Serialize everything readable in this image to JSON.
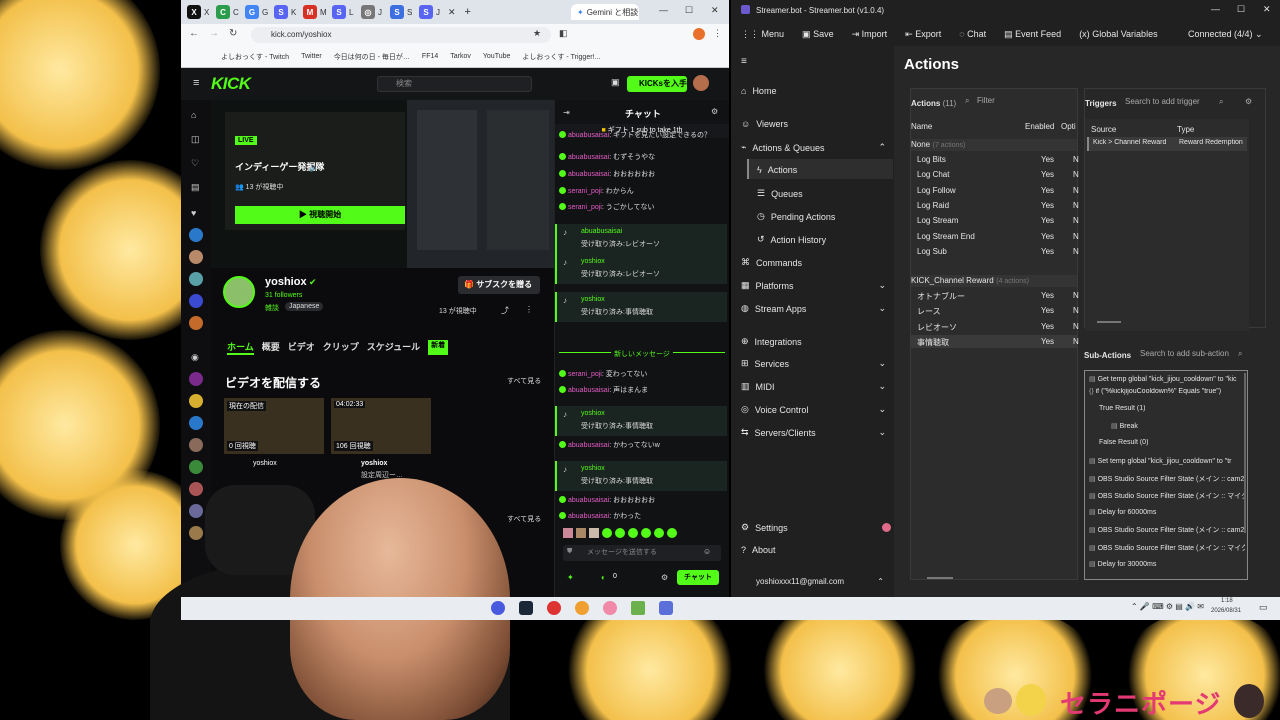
{
  "browser": {
    "tabs": [
      "X",
      "C",
      "G",
      "K",
      "M",
      "L",
      "J",
      "S",
      "J"
    ],
    "active_tab": "Gemini と相談",
    "url": "kick.com/yoshiox",
    "bookmarks": [
      "よしおっくす - Twitch",
      "Twitter",
      "今日は何の日 - 毎日が…",
      "FF14",
      "Tarkov",
      "YouTube",
      "よしおっくす - Trigger!..."
    ]
  },
  "kick": {
    "logo": "KICK",
    "search_placeholder": "検索",
    "cta": "KICKsを入手",
    "player": {
      "live": "LIVE",
      "title": "インディーゲー発掘隊",
      "viewers": "13 が視聴中",
      "watch_button": "視聴開始"
    },
    "channel": {
      "name": "yoshiox",
      "followers": "31 followers",
      "category": "雑談",
      "language": "Japanese",
      "subscribe": "サブスクを贈る",
      "viewing": "13 が視聴中",
      "tabs": [
        "ホーム",
        "概要",
        "ビデオ",
        "クリップ",
        "スケジュール"
      ],
      "new_badge": "新着",
      "section_title": "ビデオを配信する",
      "see_all": "すべて見る",
      "videos": [
        {
          "badge": "現在の配信",
          "views": "0 回視聴",
          "author": "yoshiox"
        },
        {
          "badge": "04:02:33",
          "views": "106 回視聴",
          "author": "yoshiox",
          "title": "設定周辺ー…"
        }
      ]
    },
    "chat": {
      "title": "チャット",
      "pinned": "ギフト 1 sub to take 1th",
      "new_messages": "新しいメッセージ",
      "messages": [
        {
          "user": "abuabusaisai",
          "text": "ギフトを見たい設定できるの？"
        },
        {
          "user": "abuabusaisai",
          "text": "むずそうやな"
        },
        {
          "user": "abuabusaisai",
          "text": "おおおおおお"
        },
        {
          "user": "serani_poji",
          "text": "わからん"
        },
        {
          "user": "serani_poji",
          "text": "うごかしてない"
        },
        {
          "user": "abuabusaisai",
          "text": "受け取り済み:レビオーソ",
          "redeem": true
        },
        {
          "user": "yoshiox",
          "text": "受け取り済み:レビオーソ",
          "redeem": true
        },
        {
          "user": "yoshiox",
          "text": "受け取り済み:事情聴取",
          "redeem": true
        },
        {
          "user": "serani_poji",
          "text": "変わってない"
        },
        {
          "user": "abuabusaisai",
          "text": "声はまんま"
        },
        {
          "user": "yoshiox",
          "text": "受け取り済み:事情聴取",
          "redeem": true
        },
        {
          "user": "abuabusaisai",
          "text": "かわってないw"
        },
        {
          "user": "yoshiox",
          "text": "受け取り済み:事情聴取",
          "redeem": true
        },
        {
          "user": "abuabusaisai",
          "text": "おおおおおお"
        },
        {
          "user": "abuabusaisai",
          "text": "かわった"
        }
      ],
      "input_placeholder": "メッセージを送信する",
      "points": "0",
      "send": "チャット"
    }
  },
  "streamerbot": {
    "window_title": "Streamer.bot - Streamer.bot (v1.0.4)",
    "menu": [
      "Menu",
      "Save",
      "Import",
      "Export",
      "Chat",
      "Event Feed",
      "Global Variables"
    ],
    "status": "Connected (4/4)",
    "nav": [
      "Home",
      "Viewers",
      "Actions & Queues",
      "Actions",
      "Queues",
      "Pending Actions",
      "Action History",
      "Commands",
      "Platforms",
      "Stream Apps",
      "Integrations",
      "Services",
      "MIDI",
      "Voice Control",
      "Servers/Clients",
      "Settings",
      "About"
    ],
    "account": "yoshioxxx11@gmail.com",
    "page_title": "Actions",
    "actions_label": "Actions",
    "actions_count": "(11)",
    "filter_placeholder": "Filter",
    "columns": [
      "Name",
      "Enabled",
      "Opti"
    ],
    "group_none": "None",
    "group_none_count": "(7 actions)",
    "actions_none": [
      "Log Bits",
      "Log Chat",
      "Log Follow",
      "Log Raid",
      "Log Stream",
      "Log Stream End",
      "Log Sub"
    ],
    "group_kick": "KICK_Channel Reward",
    "group_kick_count": "(4 actions)",
    "actions_kick": [
      "オトナブルー",
      "レース",
      "レビオーソ",
      "事情聴取"
    ],
    "enabled": "Yes",
    "triggers_label": "Triggers",
    "triggers_search": "Search to add trigger",
    "trigger_cols": [
      "Source",
      "Type"
    ],
    "trigger_row": [
      "Kick > Channel Reward",
      "Reward Redemption"
    ],
    "subactions_label": "Sub-Actions",
    "subactions_search": "Search to add sub-action",
    "subactions": [
      "Get temp global \"kick_jijou_cooldown\" to \"kic",
      "if (\"%kickjijouCooldown%\" Equals \"true\")",
      "True Result (1)",
      "Break",
      "False Result (0)",
      "Set temp global \"kick_jijou_cooldown\" to \"tr",
      "OBS Studio Source Filter State (メイン :: cam2",
      "OBS Studio Source Filter State (メイン :: マイク",
      "Delay for 60000ms",
      "OBS Studio Source Filter State (メイン :: cam2",
      "OBS Studio Source Filter State (メイン :: マイク",
      "Delay for 30000ms"
    ]
  },
  "taskbar": {
    "time": "1:18",
    "date": "2026/08/31"
  },
  "overlay": {
    "brand": "セラニポージ"
  }
}
